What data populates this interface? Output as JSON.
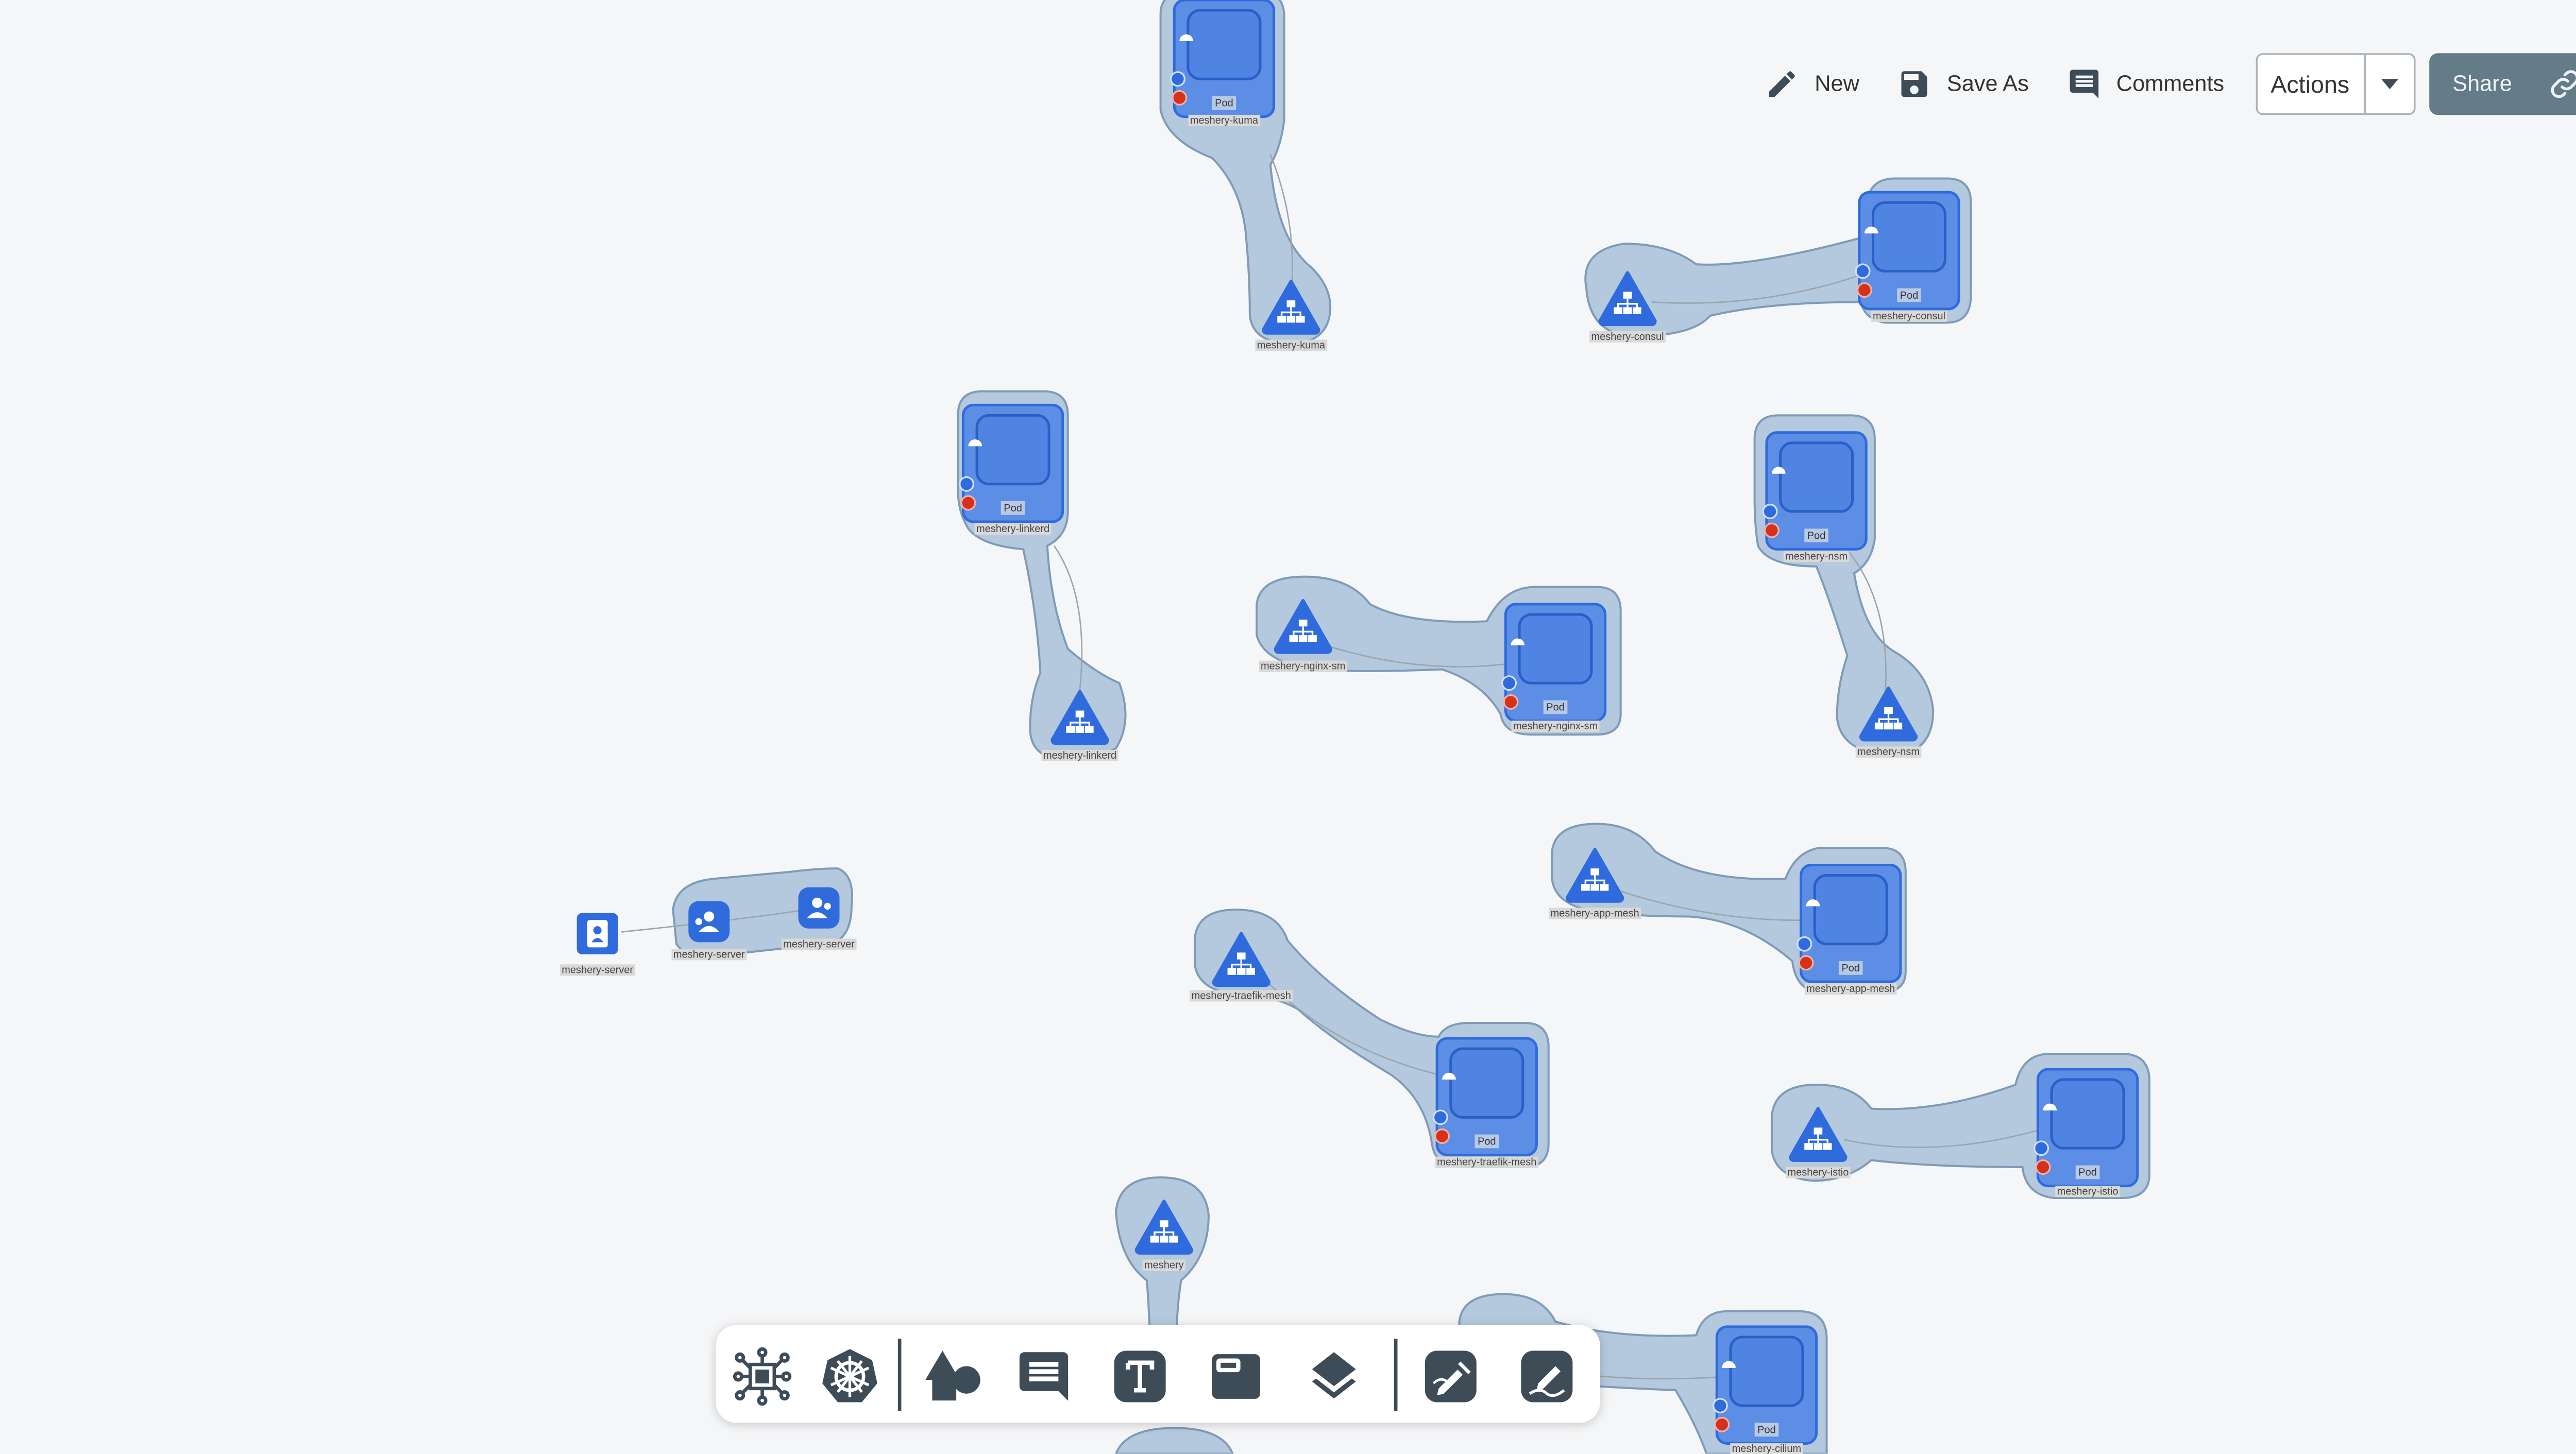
{
  "toolbar": {
    "new_label": "New",
    "save_as_label": "Save As",
    "comments_label": "Comments",
    "actions_label": "Actions",
    "share_label": "Share"
  },
  "graph": {
    "pod_label": "Pod",
    "node_labels": {
      "kuma_pod": "meshery-kuma",
      "kuma_svc": "meshery-kuma",
      "consul_svc": "meshery-consul",
      "consul_pod": "meshery-consul",
      "linkerd_pod": "meshery-linkerd",
      "linkerd_svc": "meshery-linkerd",
      "nginx_svc": "meshery-nginx-sm",
      "nginx_pod": "meshery-nginx-sm",
      "nsm_pod": "meshery-nsm",
      "nsm_svc": "meshery-nsm",
      "server_a": "meshery-server",
      "server_b": "meshery-server",
      "server_c": "meshery-server",
      "appmesh_svc": "meshery-app-mesh",
      "appmesh_pod": "meshery-app-mesh",
      "traefik_svc": "meshery-traefik-mesh",
      "traefik_pod": "meshery-traefik-mesh",
      "istio_svc": "meshery-istio",
      "istio_pod": "meshery-istio",
      "meshery_svc": "meshery",
      "cilium_pod": "meshery-cilium"
    }
  },
  "dock": {
    "tools": [
      "components-icon",
      "kubernetes-icon",
      "shapes-icon",
      "comment-icon",
      "text-icon",
      "section-icon",
      "layers-icon",
      "pen-icon",
      "freehand-icon"
    ]
  },
  "colors": {
    "canvas": "#f5f6f7",
    "group_fill": "#b4c9dd",
    "group_stroke": "#7e9bb8",
    "node_blue": "#2f6bdc",
    "pod_fill": "#5c8ee6",
    "share_bg": "#647b88",
    "error_dot": "#d4321a"
  }
}
